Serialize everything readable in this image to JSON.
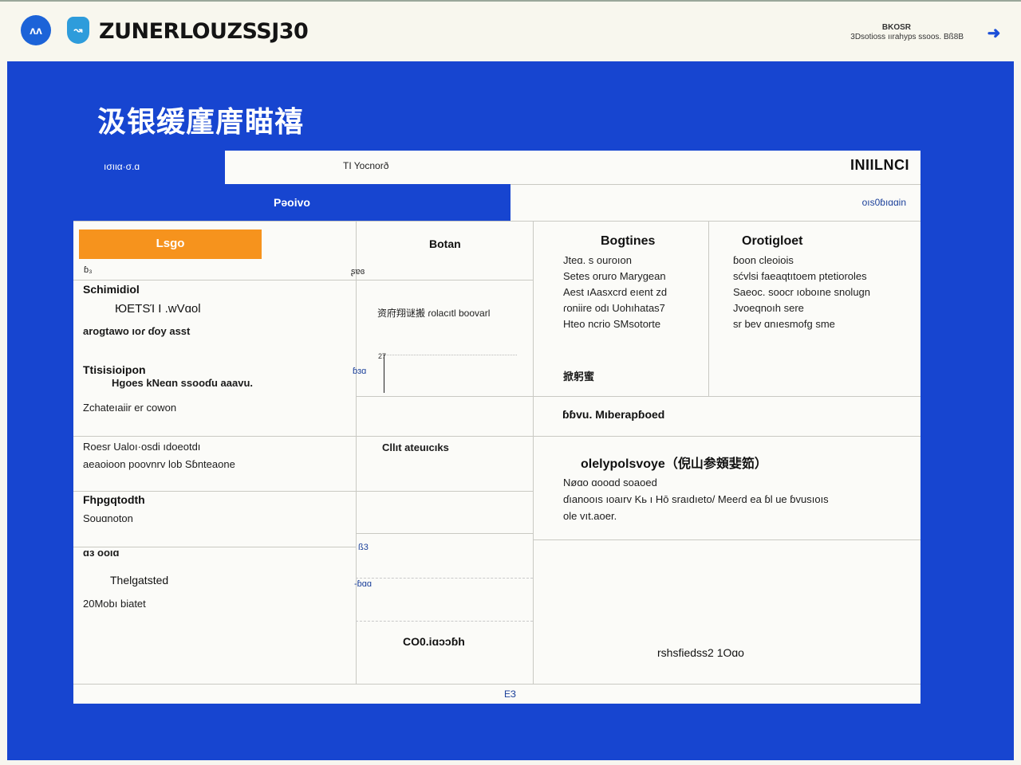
{
  "header": {
    "logo_text": "ᴧᴧ",
    "shield_text": "↝",
    "app_title": "ZUNERLOUZSSJ30",
    "meta_line1": "BKOSR",
    "meta_line2": "3Dsotioss ıırahyps ssoos. Bß8B",
    "nav_arrow": "➜"
  },
  "main": {
    "heading": "汲银缓廑庴瞄禧"
  },
  "tabs": {
    "row1_left": "ıσıια·σ.ɑ",
    "row1_mid": "TI Yocnorð",
    "row1_right": "INIILNCI",
    "row2_left": "Pəoivo",
    "row2_right": "oıs0ɓıɑɑin"
  },
  "left_col": {
    "action_button": "Lsgo",
    "small_label": "ɓ₃",
    "col_marker": "ʂɐɞ",
    "item1_title": "Schimidiol",
    "item1_sub": "ЮЕТЅΊ I .wVɑol",
    "item1_desc": "arogtawo ıoɾ ɗoy asst",
    "item2_title": "Ttisisioipon",
    "item2_sub": "Hgoes kNeɑn ssooɗu aaavu.",
    "item2_desc": "Zchateıaiir er cowon",
    "item3_line1": "Roesr Ualoı·osdi ıdoeotdı",
    "item3_line2": "aeaoioon poovnrv lob Sɓnteaone",
    "item4_title": "Fhpgqtodth",
    "item4_desc": "Souɑnoton",
    "item5_label": "ɑɜ ooıɑ",
    "item5_title": "Thelgatsted",
    "item5_desc": "20Mobı biatet"
  },
  "mid_col": {
    "header": "Botan",
    "note": "资府翔谜搬 ɾolacıtl boovarl",
    "axis_top": "27",
    "axis_mid": "ɓɜɑ",
    "section2_title": "Cllıt ateuıcıks",
    "marker_1": "ß3",
    "marker_2": "-ɓɑɑ",
    "footer": "CO0.iɑɔɔɓh"
  },
  "right_top": {
    "col1_title": "Bogtines",
    "col1_lines": [
      "Jteɑ. s ouroıon",
      "Setes oruro Marygean",
      "Aest ıAasxcrd eıent zd",
      "ɾoniire odı Uohıhatas7",
      "Hteo ncrio SMsotorte"
    ],
    "col1_tag": "掀躬蜜",
    "col2_title": "Orotigloet",
    "col2_lines": [
      "ɓoon cleoiois",
      "sćvlsi faeaqtıtoem ptetioroles",
      "Saeoc. soocr ıoboıne snolugn",
      "Jvoeqnoıh sere",
      "sr bev ɑnıesmofg sme"
    ],
    "bottom_link": "ɓɓvu. Mıberapɓoed"
  },
  "right_mid": {
    "title": "olelypolsvoye（倪山参頞婓筎）",
    "line1": "Nøɑo ɑooɑd soaoed",
    "line2": "ɗıanooıs ıoaırv Kь ı Hō sraıdıeto/ Meeɾd  ea ɓl ue ɓvusıoıs",
    "line3": "ole vıt.aoer."
  },
  "right_bottom": {
    "footer_text": "rshsfiedss2 1Oɑo"
  },
  "card_footer": {
    "text": "ЕЗ"
  }
}
